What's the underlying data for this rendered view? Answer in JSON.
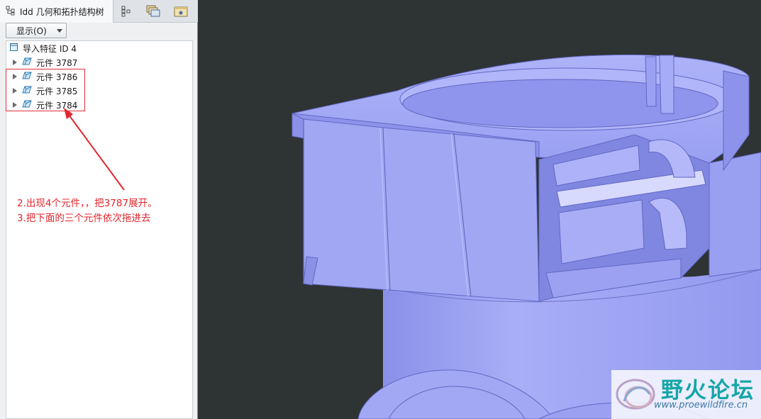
{
  "panel": {
    "active_tab": "Idd 几何和拓扑结构树",
    "show_dropdown": "显示(O)",
    "tree": {
      "root": "导入特征 ID 4",
      "items": [
        "元件 3787",
        "元件 3786",
        "元件 3785",
        "元件 3784"
      ]
    }
  },
  "annotation": {
    "line1": "2.出现4个元件，，把3787展开。",
    "line2": "3.把下面的三个元件依次拖进去",
    "color": "#e3262c"
  },
  "watermark": {
    "title": "野火论坛",
    "url": "www.proewildfire.cn"
  },
  "colors": {
    "model": "#a4a9f4",
    "background": "#2e3334"
  },
  "icons": [
    "tree-structure-icon",
    "tree-view-icon",
    "layers-icon",
    "favorites-icon",
    "feature-box-icon",
    "part-icon"
  ]
}
